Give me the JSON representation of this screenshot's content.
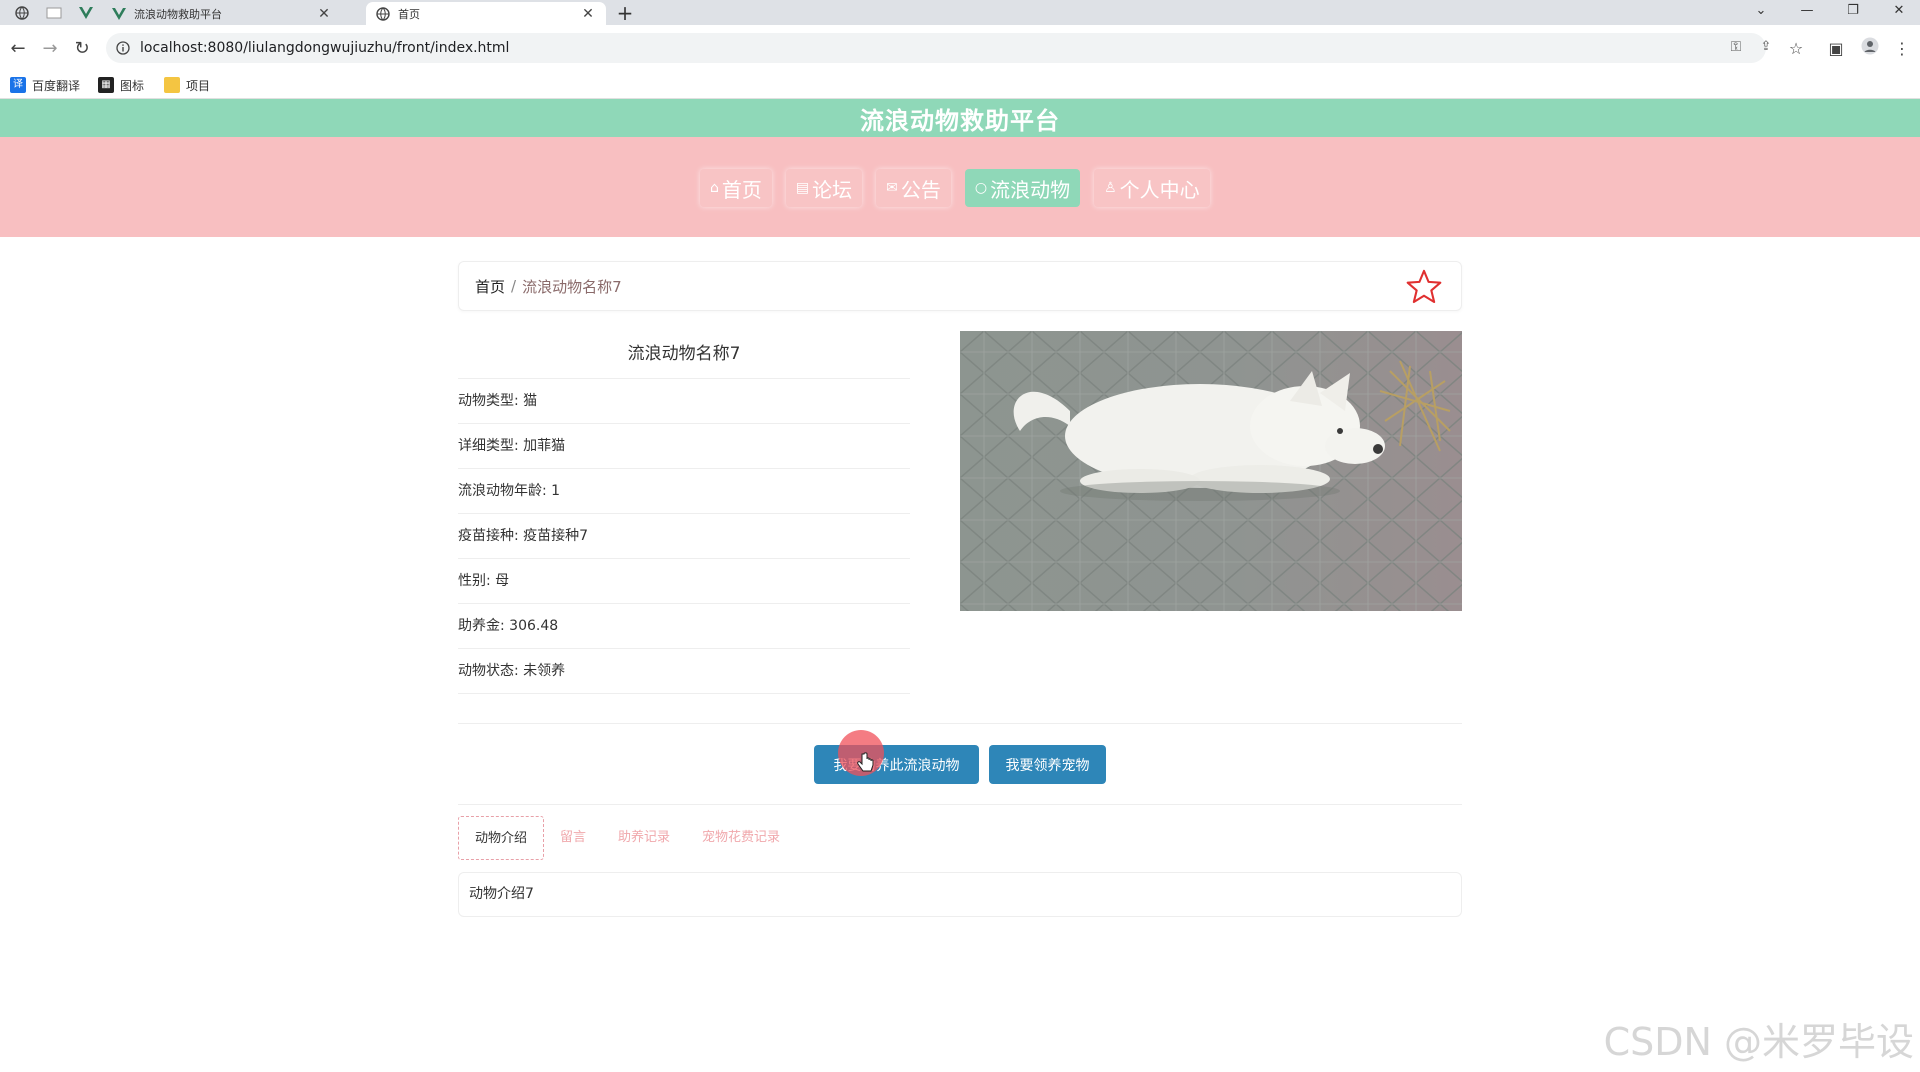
{
  "browser": {
    "tabs": [
      {
        "title": "流浪动物救助平台",
        "active": false
      },
      {
        "title": "首页",
        "active": true
      }
    ],
    "url": "localhost:8080/liulangdongwujiuzhu/front/index.html",
    "bookmarks": [
      {
        "label": "百度翻译",
        "icon": "translate-icon",
        "color": "#1a73e8"
      },
      {
        "label": "图标",
        "icon": "image-icon",
        "color": "#222222"
      },
      {
        "label": "项目",
        "icon": "folder-icon",
        "color": "#f4c542"
      }
    ]
  },
  "site": {
    "title": "流浪动物救助平台",
    "header_color": "#8fd8b8",
    "nav_band_color": "#f8bfc1",
    "nav": [
      {
        "label": "首页",
        "icon": "home-icon",
        "active": false
      },
      {
        "label": "论坛",
        "icon": "forum-icon",
        "active": false
      },
      {
        "label": "公告",
        "icon": "mail-icon",
        "active": false
      },
      {
        "label": "流浪动物",
        "icon": "circle-icon",
        "active": true
      },
      {
        "label": "个人中心",
        "icon": "user-icon",
        "active": false
      }
    ]
  },
  "breadcrumb": {
    "home": "首页",
    "separator": "/",
    "current": "流浪动物名称7"
  },
  "detail": {
    "title": "流浪动物名称7",
    "rows": [
      "动物类型: 猫",
      "详细类型: 加菲猫",
      "流浪动物年龄: 1",
      "疫苗接种: 疫苗接种7",
      "性别: 母",
      "助养金: 306.48",
      "动物状态: 未领养"
    ]
  },
  "actions": {
    "sponsor": "我要助养此流浪动物",
    "adopt": "我要领养宠物",
    "button_color": "#2e86b8"
  },
  "content_tabs": {
    "items": [
      "动物介绍",
      "留言",
      "助养记录",
      "宠物花费记录"
    ],
    "active_index": 0
  },
  "intro": {
    "text": "动物介绍7"
  },
  "watermark": "CSDN @米罗毕设"
}
